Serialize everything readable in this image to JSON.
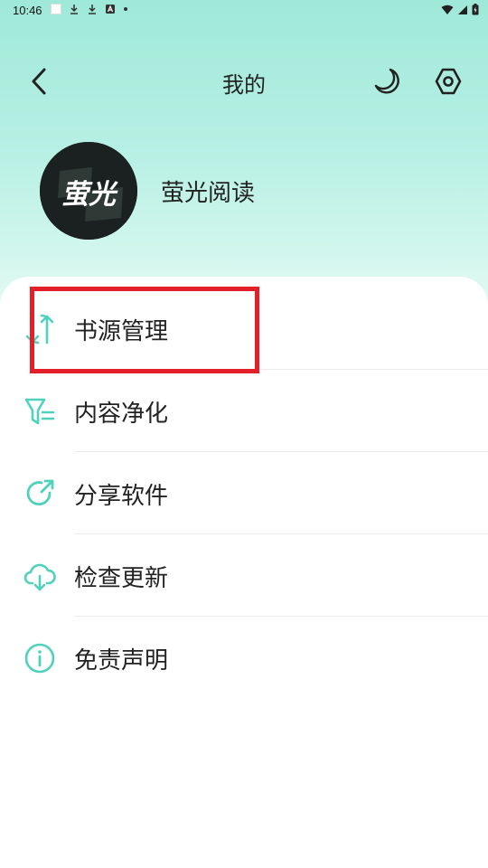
{
  "status_bar": {
    "time": "10:46"
  },
  "header": {
    "title": "我的"
  },
  "profile": {
    "name": "萤光阅读",
    "avatar_text": "萤光"
  },
  "menu": {
    "items": [
      {
        "label": "书源管理",
        "icon": "swap-vertical-icon"
      },
      {
        "label": "内容净化",
        "icon": "filter-icon"
      },
      {
        "label": "分享软件",
        "icon": "share-icon"
      },
      {
        "label": "检查更新",
        "icon": "cloud-download-icon"
      },
      {
        "label": "免责声明",
        "icon": "info-icon"
      }
    ]
  },
  "colors": {
    "accent": "#4FD1BC",
    "highlight": "#E3202A",
    "header_bg_top": "#9FE9D8"
  }
}
